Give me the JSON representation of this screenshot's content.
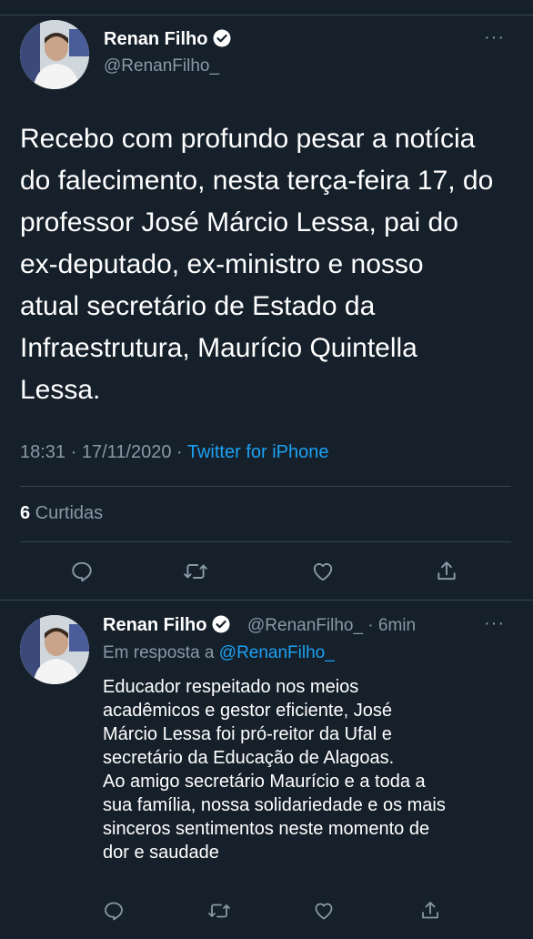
{
  "main_tweet": {
    "author_name": "Renan Filho",
    "author_handle": "@RenanFilho_",
    "more": "···",
    "text_lines": [
      "Recebo com profundo pesar a notícia",
      "do falecimento, nesta terça-feira 17, do",
      "professor José Márcio Lessa, pai do",
      "ex-deputado, ex-ministro e nosso",
      "atual secretário de Estado da",
      "Infraestrutura, Maurício Quintella",
      "Lessa."
    ],
    "time": "18:31 · 17/11/2020 · ",
    "source": "Twitter for iPhone",
    "likes_count": "6",
    "likes_label": " Curtidas"
  },
  "reply_tweet": {
    "author_name": "Renan Filho",
    "author_handle": "@RenanFilho_ · 6min",
    "more": "···",
    "reply_prefix": "Em resposta a ",
    "reply_to": "@RenanFilho_",
    "text_lines": [
      "Educador respeitado nos meios",
      "acadêmicos e gestor eficiente, José",
      "Márcio Lessa foi pró-reitor da Ufal e",
      "secretário da Educação de Alagoas.",
      "Ao amigo secretário Maurício e a toda a",
      "sua família, nossa solidariedade e os mais",
      "sinceros sentimentos neste momento de",
      "dor e saudade"
    ]
  },
  "icons": {
    "reply": "reply-icon",
    "retweet": "retweet-icon",
    "like": "like-icon",
    "share": "share-icon",
    "verified": "verified-badge-icon"
  },
  "colors": {
    "background": "#15202b",
    "accent": "#1da1f2",
    "muted": "#8899a6",
    "divider": "#38444d"
  }
}
